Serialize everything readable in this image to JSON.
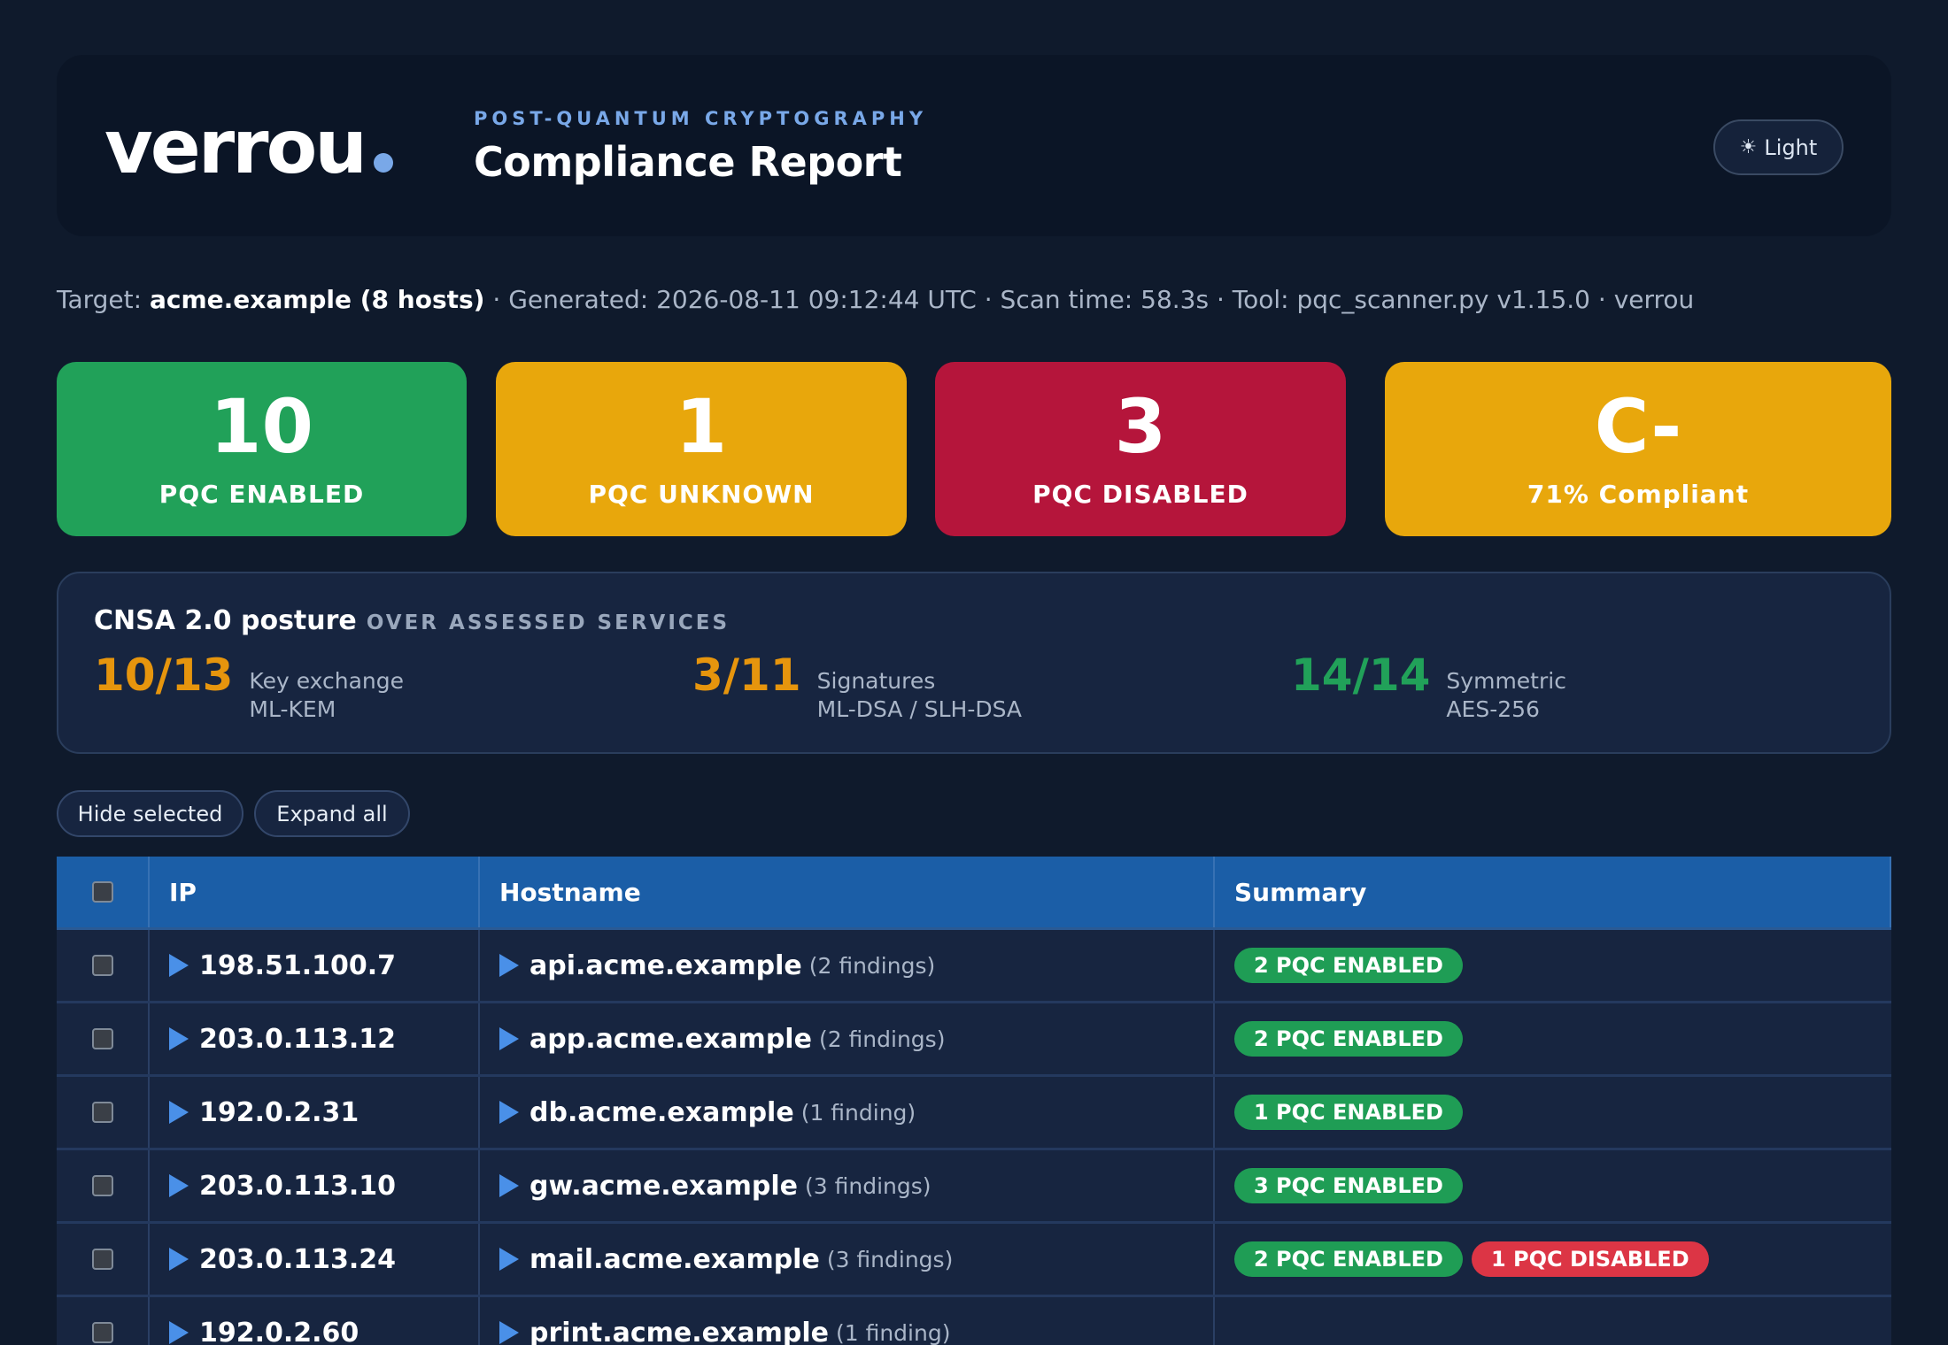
{
  "header": {
    "logo": "verrou",
    "eyebrow": "POST-QUANTUM CRYPTOGRAPHY",
    "title": "Compliance Report",
    "theme_icon": "sun-icon",
    "theme_label": "Light"
  },
  "meta": {
    "target_label": "Target:",
    "target_value": "acme.example (8 hosts)",
    "rest": "· Generated: 2026-08-11 09:12:44 UTC · Scan time: 58.3s · Tool: pqc_scanner.py v1.15.0 · verrou"
  },
  "stats": [
    {
      "value": "10",
      "label": "PQC ENABLED",
      "color": "#21a159"
    },
    {
      "value": "1",
      "label": "PQC UNKNOWN",
      "color": "#e8a70c"
    },
    {
      "value": "3",
      "label": "PQC DISABLED",
      "color": "#b5153b"
    },
    {
      "value": "C-",
      "label": "71% Compliant",
      "color": "#e8a70c"
    }
  ],
  "posture": {
    "title": "CNSA 2.0 posture",
    "subtitle": "OVER ASSESSED SERVICES",
    "metrics": [
      {
        "fraction": "10/13",
        "name": "Key exchange",
        "algo": "ML-KEM",
        "color": "#e6950d"
      },
      {
        "fraction": "3/11",
        "name": "Signatures",
        "algo": "ML-DSA / SLH-DSA",
        "color": "#e6950d"
      },
      {
        "fraction": "14/14",
        "name": "Symmetric",
        "algo": "AES-256",
        "color": "#21a159"
      }
    ]
  },
  "actions": {
    "hide_selected": "Hide selected",
    "expand_all": "Expand all"
  },
  "table": {
    "columns": [
      "IP",
      "Hostname",
      "Summary"
    ],
    "rows": [
      {
        "ip": "198.51.100.7",
        "host": "api.acme.example",
        "findings": "(2 findings)",
        "badges": [
          "2 PQC ENABLED"
        ],
        "badges_disabled": []
      },
      {
        "ip": "203.0.113.12",
        "host": "app.acme.example",
        "findings": "(2 findings)",
        "badges": [
          "2 PQC ENABLED"
        ],
        "badges_disabled": []
      },
      {
        "ip": "192.0.2.31",
        "host": "db.acme.example",
        "findings": "(1 finding)",
        "badges": [
          "1 PQC ENABLED"
        ],
        "badges_disabled": []
      },
      {
        "ip": "203.0.113.10",
        "host": "gw.acme.example",
        "findings": "(3 findings)",
        "badges": [
          "3 PQC ENABLED"
        ],
        "badges_disabled": []
      },
      {
        "ip": "203.0.113.24",
        "host": "mail.acme.example",
        "findings": "(3 findings)",
        "badges": [
          "2 PQC ENABLED"
        ],
        "badges_disabled": [
          "1 PQC DISABLED"
        ]
      },
      {
        "ip": "192.0.2.60",
        "host": "print.acme.example",
        "findings": "(1 finding)",
        "badges": [],
        "badges_disabled": []
      }
    ]
  }
}
